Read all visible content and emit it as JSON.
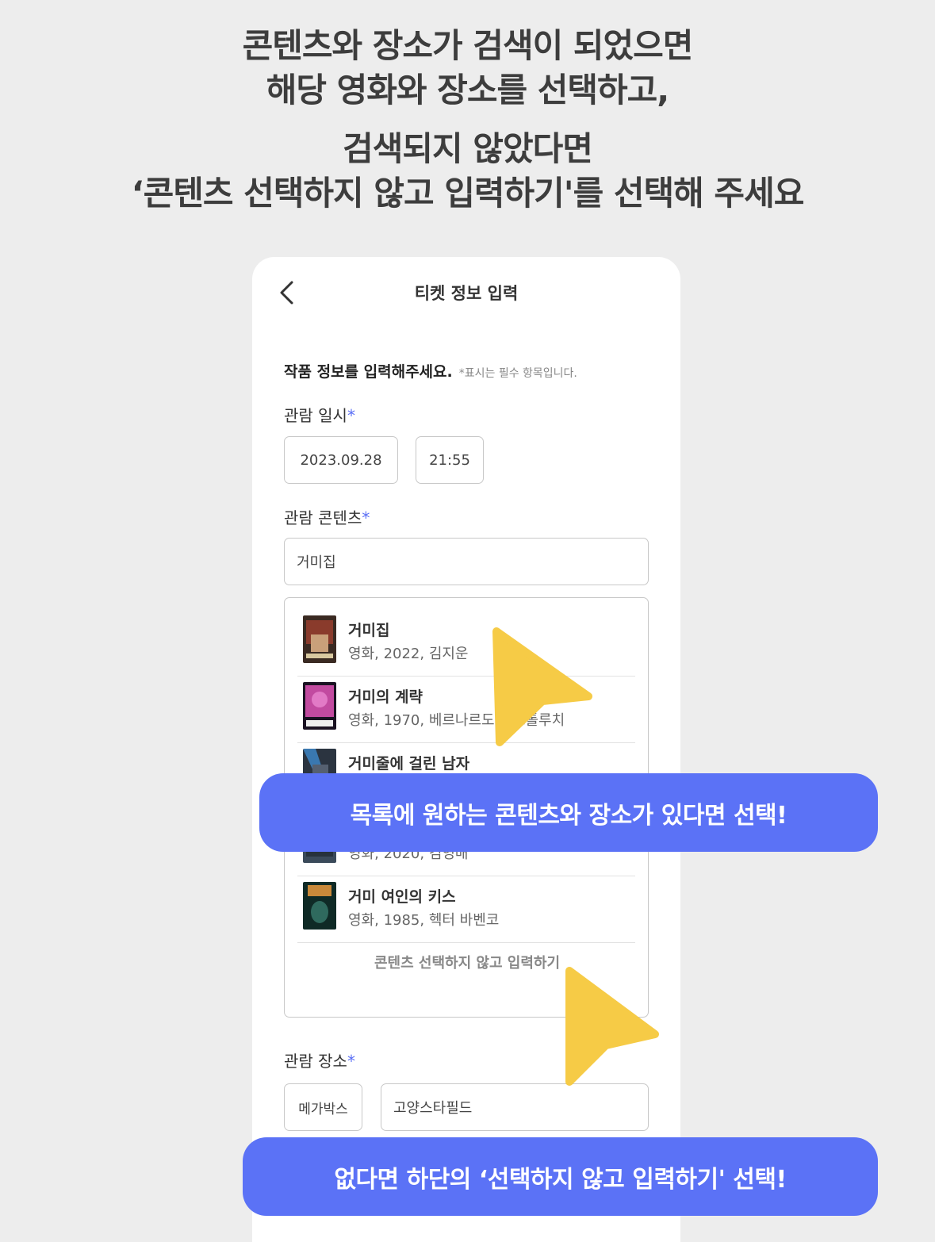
{
  "headline": {
    "line1": "콘텐츠와 장소가 검색이 되었으면",
    "line2": "해당 영화와 장소를 선택하고,",
    "line3": "검색되지 않았다면",
    "line4": "‘콘텐츠 선택하지 않고 입력하기'를 선택해 주세요"
  },
  "screen": {
    "title": "티켓 정보 입력",
    "intro": "작품 정보를 입력해주세요.",
    "intro_note": "*표시는 필수 항목입니다.",
    "required_mark": "*",
    "datetime": {
      "label": "관람 일시",
      "date": "2023.09.28",
      "time": "21:55"
    },
    "content": {
      "label": "관람 콘텐츠",
      "query": "거미집",
      "results": [
        {
          "title": "거미집",
          "subtitle": "영화, 2022, 김지운"
        },
        {
          "title": "거미의 계략",
          "subtitle": "영화, 1970, 베르나르도 베르톨루치"
        },
        {
          "title": "거미줄에 걸린 남자",
          "subtitle": ""
        },
        {
          "title": "",
          "subtitle": "영화, 2020, 김영배"
        },
        {
          "title": "거미 여인의 키스",
          "subtitle": "영화, 1985, 헥터 바벤코"
        }
      ],
      "skip_label": "콘텐츠 선택하지 않고 입력하기"
    },
    "venue": {
      "label": "관람 장소",
      "brand": "메가박스",
      "branch": "고양스타필드"
    }
  },
  "callouts": {
    "top": "목록에 원하는 콘텐츠와 장소가 있다면 선택!",
    "bottom": "없다면 하단의 ‘선택하지 않고 입력하기' 선택!"
  },
  "colors": {
    "accent": "#5b72f6",
    "pointer": "#f6cb46",
    "background": "#ededed"
  },
  "icons": [
    "back-arrow-icon",
    "pointer-cursor-icon"
  ]
}
